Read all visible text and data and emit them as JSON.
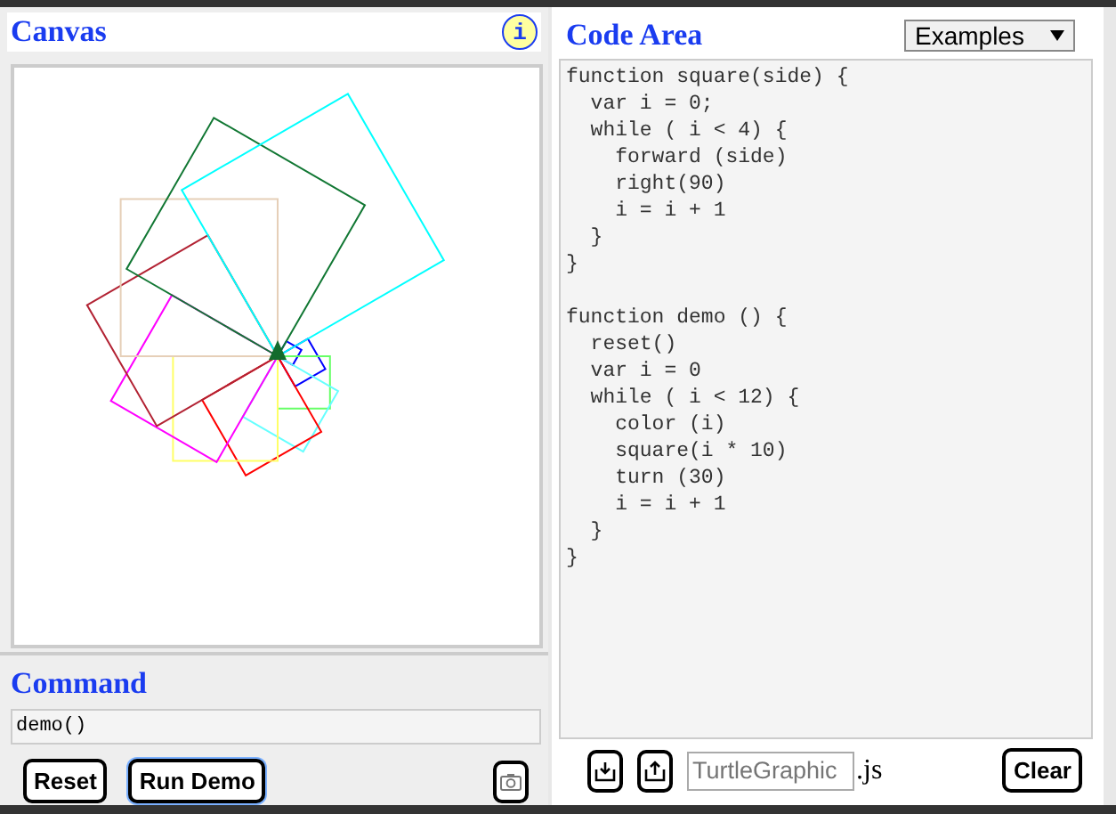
{
  "canvas_panel": {
    "title": "Canvas",
    "info_label": "i"
  },
  "command_panel": {
    "title": "Command",
    "value": "demo()",
    "buttons": [
      "Reset",
      "Run Demo"
    ]
  },
  "code_panel": {
    "title": "Code Area",
    "examples_select": "Examples",
    "code": "function square(side) {\n  var i = 0;\n  while ( i < 4) {\n    forward (side)\n    right(90)\n    i = i + 1\n  }\n}\n\nfunction demo () {\n  reset()\n  var i = 0\n  while ( i < 12) {\n    color (i)\n    square(i * 10)\n    turn (30)\n    i = i + 1\n  }\n}",
    "filename_placeholder": "TurtleGraphic",
    "extension": ".js",
    "clear_button": "Clear"
  }
}
